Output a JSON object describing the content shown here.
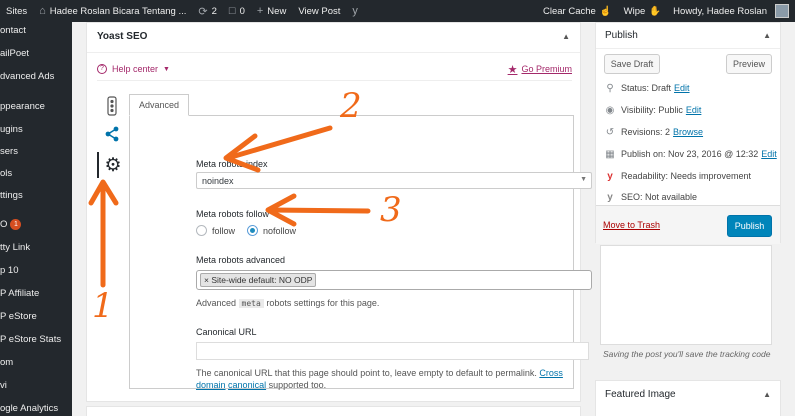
{
  "admin_bar": {
    "sites": "Sites",
    "site_name": "Hadee Roslan Bicara Tentang ...",
    "updates": "2",
    "comments": "0",
    "new": "New",
    "view_post": "View Post",
    "clear_cache": "Clear Cache",
    "wipe": "Wipe",
    "howdy": "Howdy, Hadee Roslan"
  },
  "sidebar": {
    "items": [
      "ontact",
      "ailPoet",
      "dvanced Ads",
      "ppearance",
      "ugins",
      "sers",
      "ols",
      "ttings",
      "O",
      "tty Link",
      "p 10",
      "P Affiliate",
      "P eStore",
      "P eStore Stats",
      "om",
      "vi",
      "ogle Analytics"
    ],
    "seo_badge": "1"
  },
  "yoast": {
    "title": "Yoast SEO",
    "help_center": "Help center",
    "go_premium": "Go Premium",
    "tab_advanced": "Advanced",
    "meta_index_label": "Meta robots index",
    "meta_index_value": "noindex",
    "meta_follow_label": "Meta robots follow",
    "follow_options": [
      "follow",
      "nofollow"
    ],
    "follow_selected": "nofollow",
    "meta_advanced_label": "Meta robots advanced",
    "advanced_chip": "× Site-wide default: NO ODP",
    "advanced_help_pre": "Advanced",
    "advanced_help_code": "meta",
    "advanced_help_post": "robots settings for this page.",
    "canonical_label": "Canonical URL",
    "canonical_value": "",
    "canonical_help": "The canonical URL that this page should point to, leave empty to default to permalink.",
    "canonical_link1": "Cross domain",
    "canonical_link2": "canonical",
    "canonical_help_end": "supported too."
  },
  "publish": {
    "title": "Publish",
    "save_draft": "Save Draft",
    "preview": "Preview",
    "status": "Status: Draft",
    "status_edit": "Edit",
    "visibility": "Visibility: Public",
    "visibility_edit": "Edit",
    "revisions": "Revisions: 2",
    "revisions_browse": "Browse",
    "publish_on": "Publish on: Nov 23, 2016 @ 12:32",
    "publish_on_edit": "Edit",
    "readability": "Readability: Needs improvement",
    "seo": "SEO: Not available",
    "trash": "Move to Trash",
    "publish_btn": "Publish"
  },
  "tracking_note": "Saving the post you'll save the tracking code",
  "featured_image": "Featured Image",
  "annotations": [
    "1",
    "2",
    "3"
  ],
  "colors": {
    "admin_bar": "#23282d",
    "accent": "#0085ba",
    "yoast_purple": "#a4286a",
    "arrow": "#f06a1a"
  }
}
